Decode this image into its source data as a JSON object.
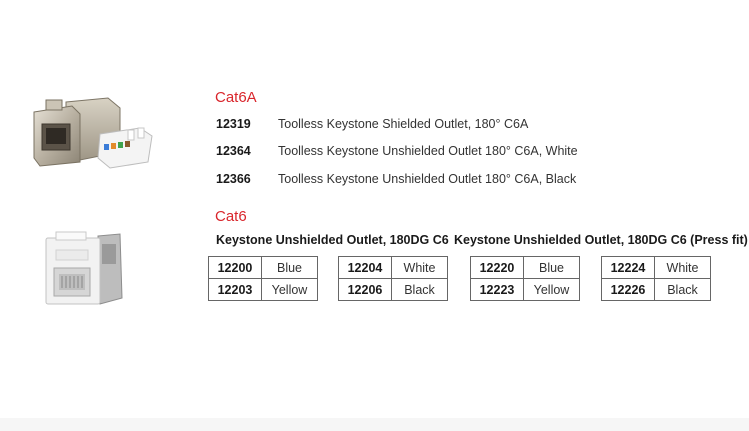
{
  "cat6a": {
    "title": "Cat6A",
    "items": [
      {
        "code": "12319",
        "desc": "Toolless Keystone Shielded Outlet, 180° C6A"
      },
      {
        "code": "12364",
        "desc": "Toolless Keystone Unshielded Outlet 180° C6A, White"
      },
      {
        "code": "12366",
        "desc": "Toolless Keystone Unshielded Outlet 180° C6A, Black"
      }
    ]
  },
  "cat6": {
    "title": "Cat6",
    "group1": {
      "heading": "Keystone Unshielded Outlet, 180DG C6",
      "tables": [
        [
          [
            "12200",
            "Blue"
          ],
          [
            "12203",
            "Yellow"
          ]
        ],
        [
          [
            "12204",
            "White"
          ],
          [
            "12206",
            "Black"
          ]
        ]
      ]
    },
    "group2": {
      "heading": "Keystone Unshielded Outlet, 180DG C6 (Press fit)",
      "tables": [
        [
          [
            "12220",
            "Blue"
          ],
          [
            "12223",
            "Yellow"
          ]
        ],
        [
          [
            "12224",
            "White"
          ],
          [
            "12226",
            "Black"
          ]
        ]
      ]
    }
  },
  "images": {
    "cat6a_image": "shielded-keystone-jack-image",
    "cat6_image": "white-keystone-jack-image"
  }
}
